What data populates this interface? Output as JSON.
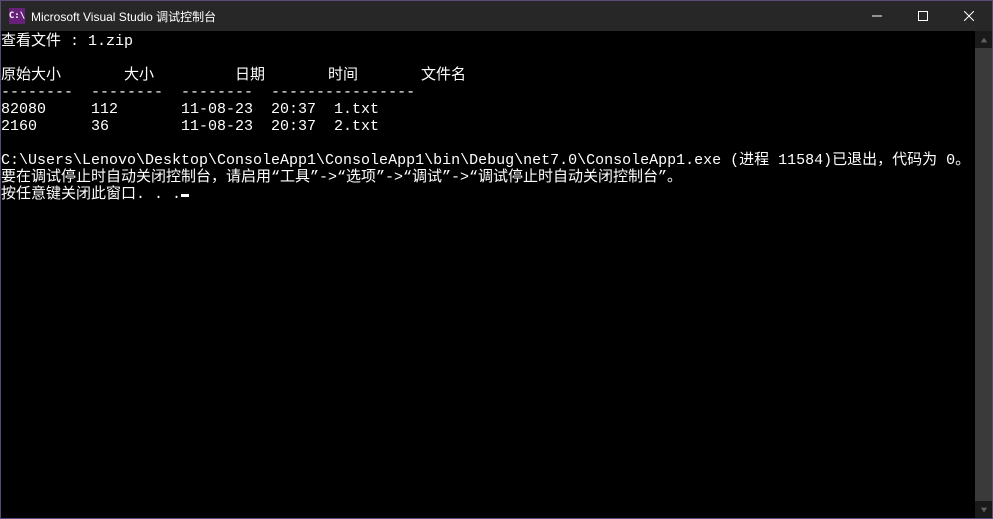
{
  "window": {
    "icon_text": "C:\\",
    "title": "Microsoft Visual Studio 调试控制台"
  },
  "console": {
    "view_line": "查看文件 : 1.zip",
    "header": {
      "original_size": "原始大小",
      "size": "大小",
      "date": "日期",
      "time": "时间",
      "filename": "文件名"
    },
    "separator": {
      "original_size": "--------",
      "size": "--------",
      "date": "--------",
      "time": "--------",
      "filename": "--------"
    },
    "rows": [
      {
        "original_size": "82080",
        "size": "112",
        "date": "11-08-23",
        "time": "20:37",
        "filename": "1.txt"
      },
      {
        "original_size": "2160",
        "size": "36",
        "date": "11-08-23",
        "time": "20:37",
        "filename": "2.txt"
      }
    ],
    "exit_line": "C:\\Users\\Lenovo\\Desktop\\ConsoleApp1\\ConsoleApp1\\bin\\Debug\\net7.0\\ConsoleApp1.exe (进程 11584)已退出，代码为 0。",
    "hint_line": "要在调试停止时自动关闭控制台，请启用“工具”->“选项”->“调试”->“调试停止时自动关闭控制台”。",
    "press_line": "按任意键关闭此窗口. . ."
  }
}
